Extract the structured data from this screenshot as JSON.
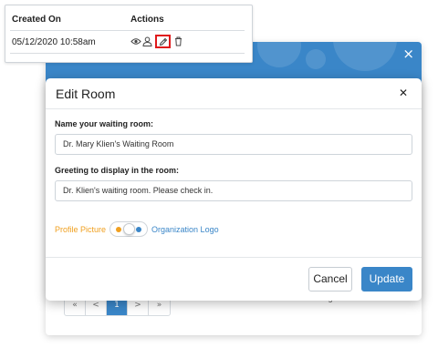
{
  "table": {
    "headers": {
      "created_on": "Created On",
      "actions": "Actions"
    },
    "rows": [
      {
        "created_on": "05/12/2020 10:58am"
      }
    ],
    "action_icons": [
      "eye-icon",
      "user-icon",
      "pencil-icon",
      "trash-icon"
    ]
  },
  "background_modal": {
    "close_glyph": "×",
    "pagination": {
      "first": "«",
      "prev": "<",
      "current": "1",
      "next": ">",
      "last": "»"
    },
    "entries_text": "Showing 1 to 1 of 1 entries"
  },
  "edit_room": {
    "title": "Edit Room",
    "close_glyph": "✕",
    "name_label": "Name your waiting room:",
    "name_value": "Dr. Mary Klien's Waiting Room",
    "greeting_label": "Greeting to display in the room:",
    "greeting_value": "Dr. Klien's waiting room. Please check in.",
    "toggle_left_label": "Profile Picture",
    "toggle_right_label": "Organization Logo",
    "cancel_label": "Cancel",
    "update_label": "Update"
  },
  "colors": {
    "accent": "#3a86c8",
    "toggle_left": "#f0a020",
    "highlight": "#e0191b"
  }
}
